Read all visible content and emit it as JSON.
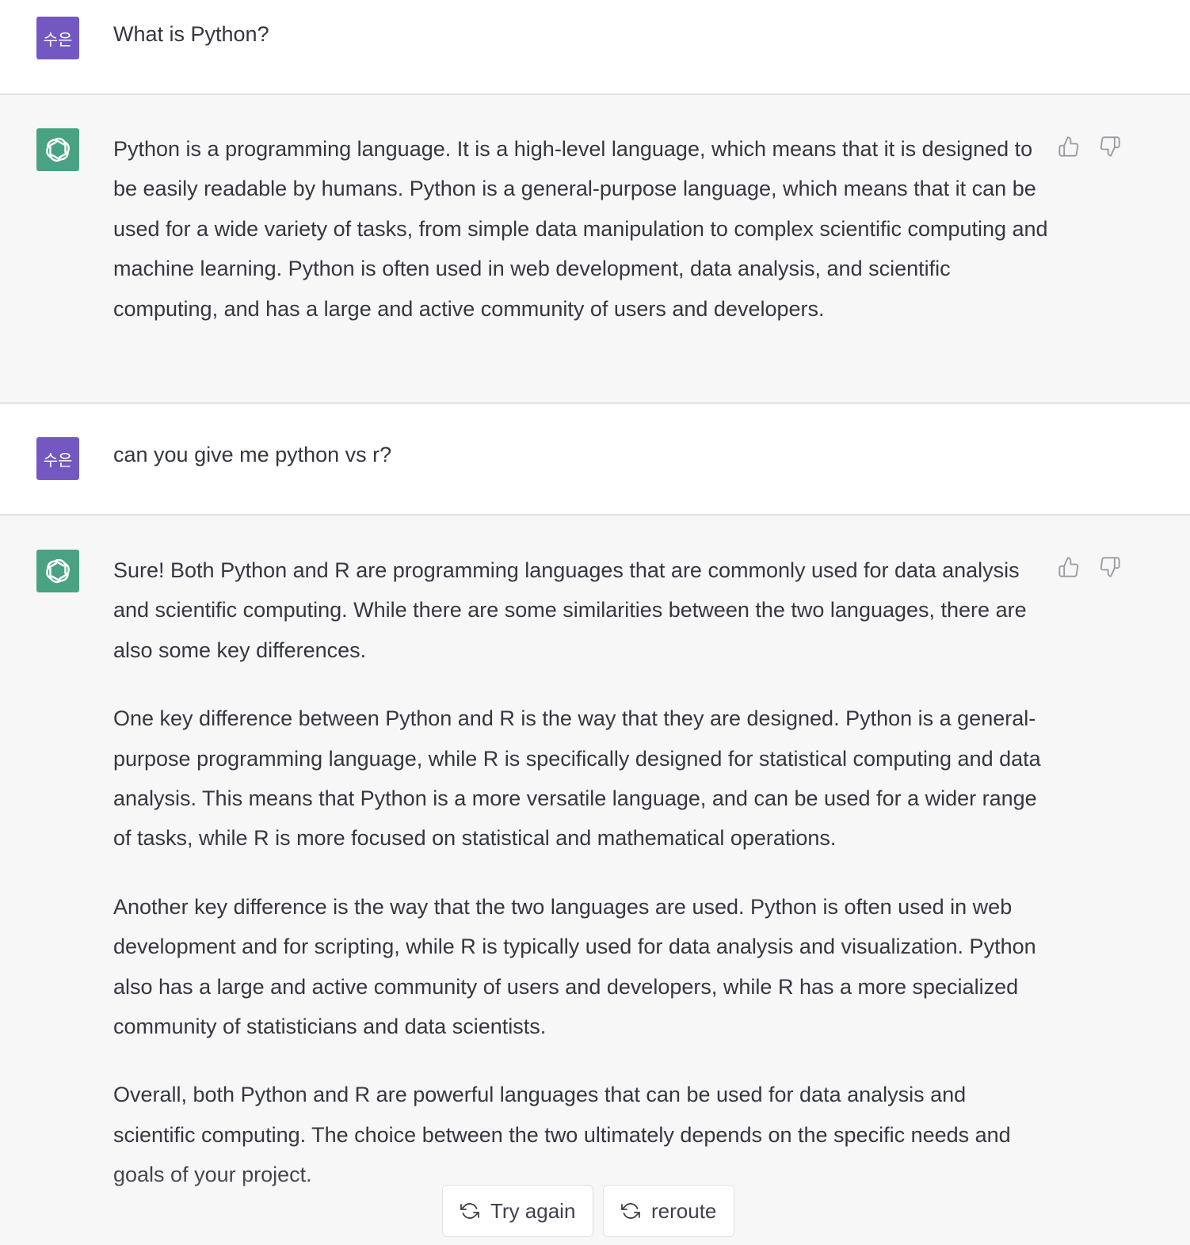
{
  "messages": [
    {
      "role": "user",
      "avatar_text": "수은",
      "paragraphs": [
        "What is Python?"
      ]
    },
    {
      "role": "assistant",
      "avatar_icon": "openai-logo-icon",
      "paragraphs": [
        "Python is a programming language. It is a high-level language, which means that it is designed to be easily readable by humans. Python is a general-purpose language, which means that it can be used for a wide variety of tasks, from simple data manipulation to complex scientific computing and machine learning. Python is often used in web development, data analysis, and scientific computing, and has a large and active community of users and developers."
      ]
    },
    {
      "role": "user",
      "avatar_text": "수은",
      "paragraphs": [
        "can you give me python vs r?"
      ]
    },
    {
      "role": "assistant",
      "avatar_icon": "openai-logo-icon",
      "paragraphs": [
        "Sure! Both Python and R are programming languages that are commonly used for data analysis and scientific computing. While there are some similarities between the two languages, there are also some key differences.",
        "One key difference between Python and R is the way that they are designed. Python is a general-purpose programming language, while R is specifically designed for statistical computing and data analysis. This means that Python is a more versatile language, and can be used for a wider range of tasks, while R is more focused on statistical and mathematical operations.",
        "Another key difference is the way that the two languages are used. Python is often used in web development and for scripting, while R is typically used for data analysis and visualization. Python also has a large and active community of users and developers, while R has a more specialized community of statisticians and data scientists.",
        "Overall, both Python and R are powerful languages that can be used for data analysis and scientific computing. The choice between the two ultimately depends on the specific needs and goals of your project."
      ]
    }
  ],
  "actions": {
    "try_again_label": "Try again",
    "reroute_label": "reroute"
  },
  "colors": {
    "user_avatar": "#7358c2",
    "assistant_avatar": "#49a383",
    "assistant_bg": "#f7f7f8",
    "text": "#353740"
  }
}
